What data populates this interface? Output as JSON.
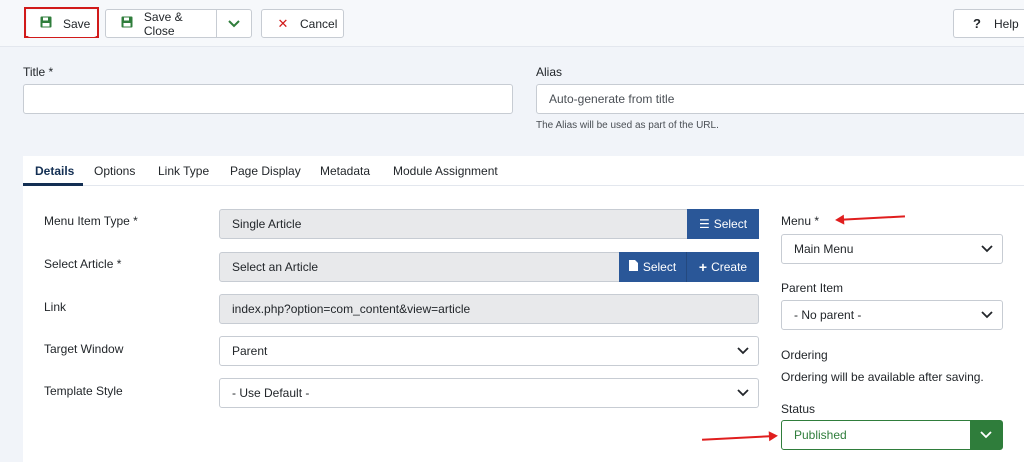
{
  "toolbar": {
    "save_label": "Save",
    "save_close_label": "Save & Close",
    "cancel_label": "Cancel",
    "help_label": "Help"
  },
  "title_field": {
    "label": "Title *",
    "value": ""
  },
  "alias_field": {
    "label": "Alias",
    "placeholder": "Auto-generate from title",
    "hint": "The Alias will be used as part of the URL."
  },
  "tabs": [
    {
      "label": "Details",
      "active": true
    },
    {
      "label": "Options"
    },
    {
      "label": "Link Type"
    },
    {
      "label": "Page Display"
    },
    {
      "label": "Metadata"
    },
    {
      "label": "Module Assignment"
    }
  ],
  "details": {
    "menu_item_type": {
      "label": "Menu Item Type *",
      "value": "Single Article",
      "select_label": "Select"
    },
    "select_article": {
      "label": "Select Article *",
      "value": "Select an Article",
      "select_label": "Select",
      "create_label": "Create"
    },
    "link": {
      "label": "Link",
      "value": "index.php?option=com_content&view=article"
    },
    "target_window": {
      "label": "Target Window",
      "value": "Parent"
    },
    "template_style": {
      "label": "Template Style",
      "value": "- Use Default -"
    }
  },
  "sidebar": {
    "menu": {
      "label": "Menu *",
      "value": "Main Menu"
    },
    "parent_item": {
      "label": "Parent Item",
      "value": "- No parent -"
    },
    "ordering": {
      "label": "Ordering",
      "text": "Ordering will be available after saving."
    },
    "status": {
      "label": "Status",
      "value": "Published"
    }
  },
  "colors": {
    "accent_navy": "#2a5798",
    "status_green": "#2f7d3b",
    "highlight_red": "#d11a1a"
  }
}
